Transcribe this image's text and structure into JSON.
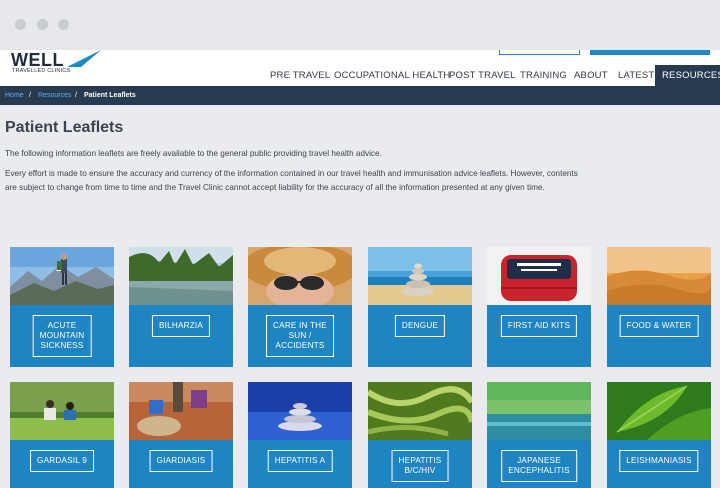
{
  "header": {
    "logo_word": "WELL",
    "logo_sub": "TRAVELLED CLINICS"
  },
  "nav": {
    "items": [
      "PRE TRAVEL",
      "OCCUPATIONAL HEALTH",
      "POST TRAVEL",
      "TRAINING",
      "ABOUT",
      "LATEST",
      "RESOURCES"
    ],
    "active": "RESOURCES"
  },
  "breadcrumb": {
    "home": "Home",
    "sep": "/",
    "resources": "Resources",
    "current": "Patient Leaflets"
  },
  "main": {
    "title": "Patient Leaflets",
    "intro": "The following information leaflets are freely available to the general public providing travel health advice.",
    "disclaimer": "Every effort is made to ensure the accuracy and currency of the information contained in our travel health and immunisation advice leaflets. However, contents are subject to change from time to time and the Travel Clinic cannot accept liability for the accuracy of all the information presented at any given time."
  },
  "leaflets": [
    {
      "label": "ACUTE\nMOUNTAIN\nSICKNESS",
      "image": "mountain-hiker"
    },
    {
      "label": "BILHARZIA",
      "image": "reed-lake"
    },
    {
      "label": "CARE IN THE\nSUN /\nACCIDENTS",
      "image": "sunhat-sunglasses"
    },
    {
      "label": "DENGUE",
      "image": "stacked-stones-beach"
    },
    {
      "label": "FIRST AID KITS",
      "image": "red-first-aid-bag"
    },
    {
      "label": "FOOD & WATER",
      "image": "desert-dunes"
    },
    {
      "label": "GARDASIL 9",
      "image": "couple-park"
    },
    {
      "label": "GIARDIASIS",
      "image": "water-pump-bucket"
    },
    {
      "label": "HEPATITIS A",
      "image": "stone-stack-blue"
    },
    {
      "label": "HEPATITIS\nB/C/HIV",
      "image": "rice-grains"
    },
    {
      "label": "JAPANESE\nENCEPHALITIS",
      "image": "rice-paddy-water"
    },
    {
      "label": "LEISHMANIASIS",
      "image": "green-leaves"
    }
  ],
  "colors": {
    "navy": "#283a4f",
    "accent_blue": "#1e84c2",
    "link_blue": "#5fb3e6",
    "page_bg": "#e9ebee"
  }
}
